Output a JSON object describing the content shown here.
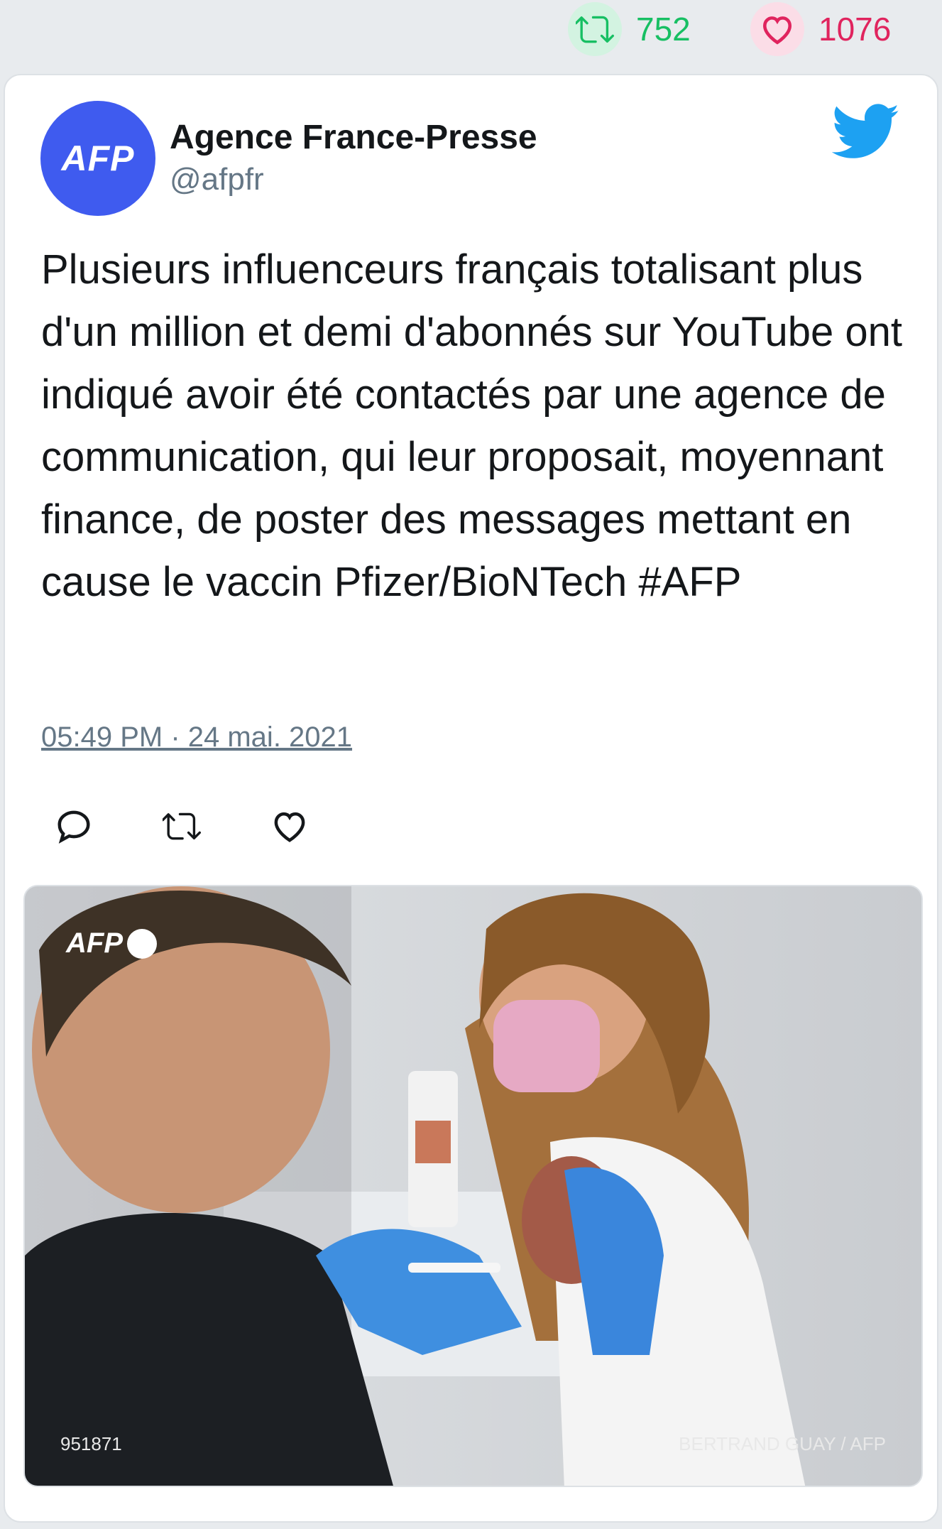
{
  "stats": {
    "retweets": "752",
    "likes": "1076",
    "retweet_color": "#17bf63",
    "like_color": "#e0245e"
  },
  "tweet": {
    "author_name": "Agence France-Presse",
    "author_handle": "@afpfr",
    "avatar_text": "AFP",
    "avatar_color": "#3f5bef",
    "text": "Plusieurs influenceurs français totalisant plus d'un million et demi d'abonnés sur YouTube ont indiqué avoir été contactés par une agence de communication, qui leur proposait, moyennant finance, de poster des messages mettant en cause le vaccin Pfizer/BioNTech #AFP",
    "timestamp": "05:49 PM · 24 mai. 2021",
    "actions": [
      "reply-icon",
      "retweet-icon",
      "like-icon"
    ]
  },
  "photo": {
    "watermark_logo": "AFP",
    "photo_id": "951871",
    "credit": "BERTRAND GUAY / AFP"
  },
  "icons": {
    "brand": "twitter-bird-icon"
  }
}
